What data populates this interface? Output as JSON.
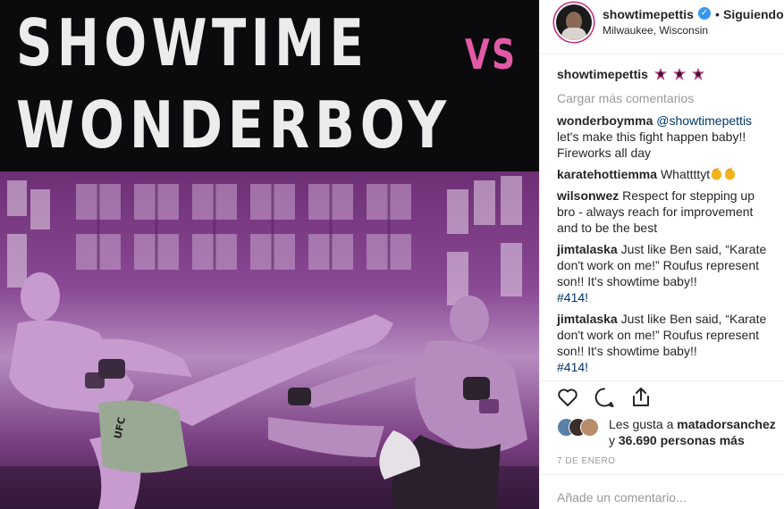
{
  "poster": {
    "line1": "SHOWTIME",
    "vs": "VS",
    "line2": "WONDERBOY",
    "fighter_left_trunks_text": "UFC"
  },
  "header": {
    "owner_name": "showtimepettis",
    "separator": "•",
    "follow_label": "Siguiendo",
    "location": "Milwaukee, Wisconsin",
    "verified_icon": "verified-check-icon"
  },
  "caption": {
    "user": "showtimepettis",
    "badge_icons": [
      "pink-star-badge-icon",
      "pink-star-badge-icon",
      "pink-star-badge-icon"
    ]
  },
  "load_more_label": "Cargar más comentarios",
  "comments": [
    {
      "user": "wonderboymma",
      "mention": "@showtimepettis",
      "text": "let's make this fight happen baby!! Fireworks all day"
    },
    {
      "user": "karatehottiemma",
      "text": "Whattttyt",
      "icons": [
        "clapping-hands-icon",
        "clapping-hands-icon"
      ]
    },
    {
      "user": "wilsonwez",
      "text": "Respect for stepping up bro - always reach for improvement and to be the best"
    },
    {
      "user": "jimtalaska",
      "text": "Just like Ben said, “Karate don't work on me!” Roufus represent son!! It's showtime baby!!",
      "hashtag": "#414!"
    },
    {
      "user": "jimtalaska",
      "text": "Just like Ben said, “Karate don't work on me!” Roufus represent son!! It's showtime baby!!",
      "hashtag": "#414!"
    }
  ],
  "actions": {
    "like_icon": "heart-icon",
    "comment_icon": "comment-bubble-icon",
    "share_icon": "share-icon"
  },
  "likes": {
    "prefix": "Les gusta a",
    "user": "matadorsanchez",
    "conjunction": "y",
    "count": "36.690 personas más"
  },
  "date": "7 de enero",
  "add_comment_placeholder": "Añade un comentario...",
  "colors": {
    "vs_pink": "#e25aa6",
    "link_blue": "#003569",
    "muted_gray": "#999999",
    "verified_blue": "#3897f0",
    "story_ring": "#c92b7b"
  }
}
